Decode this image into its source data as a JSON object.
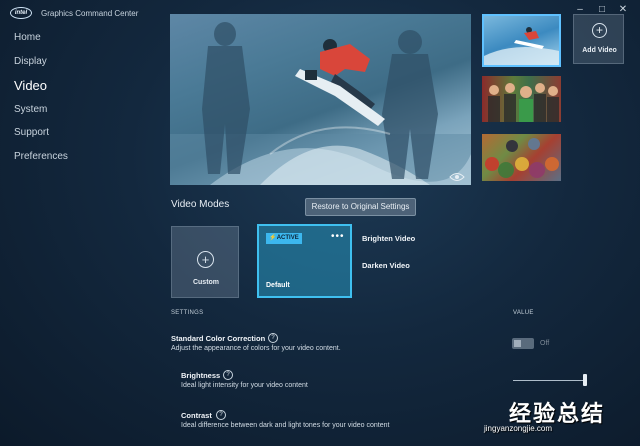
{
  "app": {
    "logo_text": "intel",
    "title": "Graphics Command Center",
    "window_controls": {
      "minimize": "–",
      "maximize": "□",
      "close": "✕"
    }
  },
  "sidebar": {
    "items": [
      {
        "label": "Home",
        "active": false
      },
      {
        "label": "Display",
        "active": false
      },
      {
        "label": "Video",
        "active": true
      },
      {
        "label": "System",
        "active": false
      },
      {
        "label": "Support",
        "active": false
      },
      {
        "label": "Preferences",
        "active": false
      }
    ]
  },
  "preview": {
    "eye_icon": "eye-icon",
    "thumbnails": [
      "snowboard",
      "group-photo",
      "food-market"
    ],
    "selected_thumbnail": 0,
    "add_video_label": "Add Video"
  },
  "video_modes": {
    "title": "Video Modes",
    "restore_button": "Restore to Original Settings",
    "custom_label": "Custom",
    "active_badge": "⚡ACTIVE",
    "more_icon": "•••",
    "default_label": "Default",
    "modes": [
      "Brighten Video",
      "Darken Video"
    ]
  },
  "settings": {
    "header": "SETTINGS",
    "value_header": "VALUE",
    "items": [
      {
        "title": "Standard Color Correction",
        "desc": "Adjust the appearance of colors for your video content.",
        "help": "?"
      },
      {
        "title": "Brightness",
        "desc": "Ideal light intensity for your video content",
        "help": "?"
      },
      {
        "title": "Contrast",
        "desc": "Ideal difference between dark and light tones for your video content",
        "help": "?"
      }
    ],
    "toggle_label": "Off",
    "brightness_value_fraction": 1.0
  },
  "watermark": {
    "text": "经验总结",
    "url": "jingyanzongjie.com"
  },
  "colors": {
    "accent": "#3fc0f0",
    "background": "#13283e"
  }
}
